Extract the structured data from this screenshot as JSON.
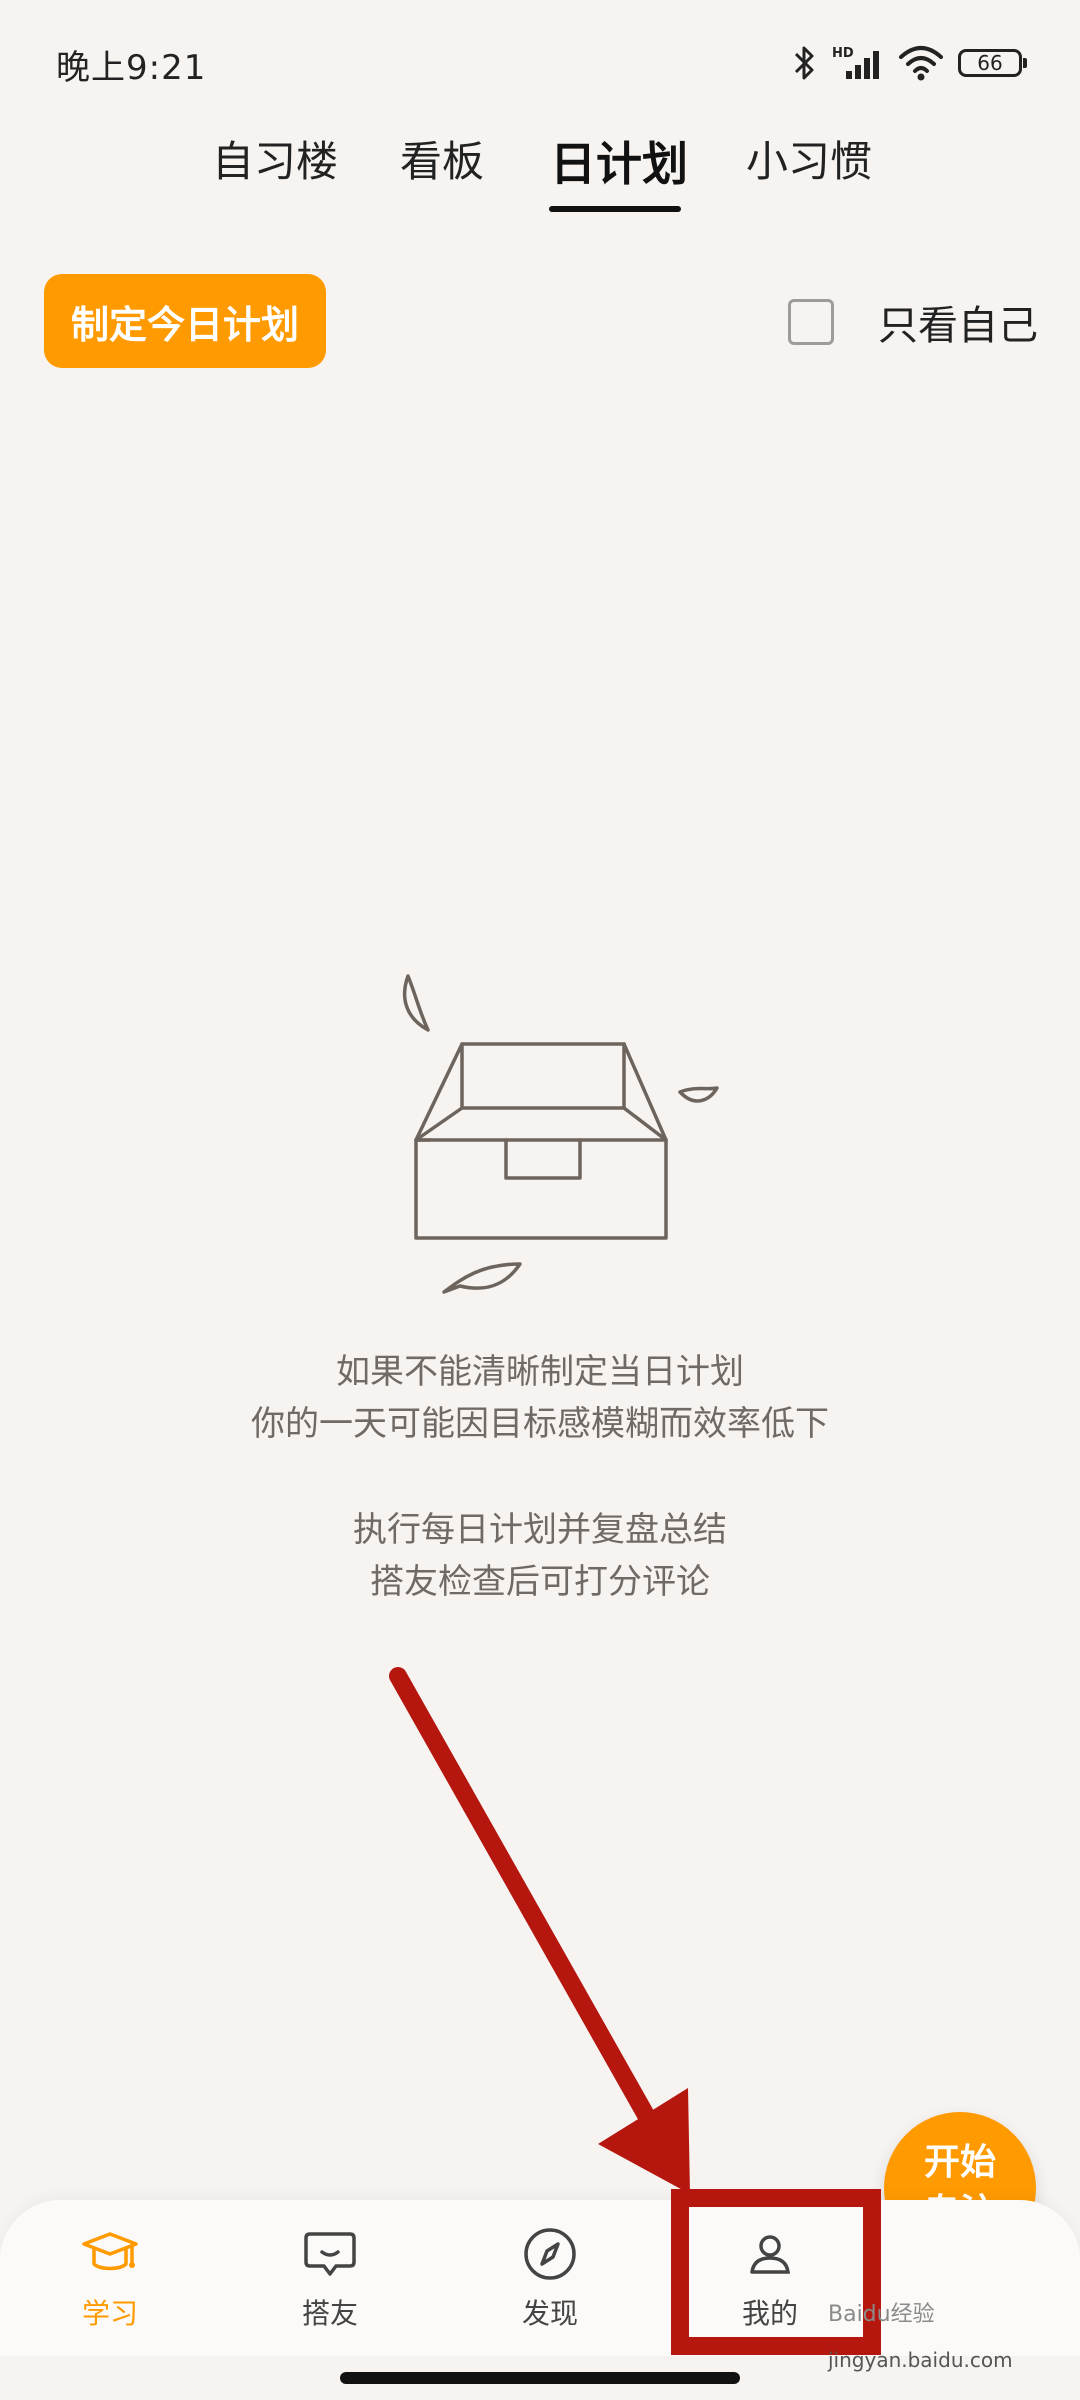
{
  "status_bar": {
    "time": "晚上9:21",
    "battery": "66",
    "icons": [
      "bluetooth-icon",
      "hd-signal-icon",
      "wifi-icon",
      "battery-icon"
    ]
  },
  "tabs": [
    {
      "label": "自习楼"
    },
    {
      "label": "看板"
    },
    {
      "label": "日计划",
      "active": true
    },
    {
      "label": "小习惯"
    }
  ],
  "actions": {
    "plan_button": "制定今日计划",
    "only_me_label": "只看自己",
    "only_me_checked": false
  },
  "empty_state": {
    "line1": "如果不能清晰制定当日计划",
    "line2": "你的一天可能因目标感模糊而效率低下",
    "line3": "执行每日计划并复盘总结",
    "line4": "搭友检查后可打分评论"
  },
  "focus_button": {
    "line1": "开始",
    "line2": "专注"
  },
  "bottom_nav": [
    {
      "label": "学习",
      "icon": "graduation-cap-icon",
      "active": true
    },
    {
      "label": "搭友",
      "icon": "chat-bubble-icon"
    },
    {
      "label": "发现",
      "icon": "compass-icon"
    },
    {
      "label": "我的",
      "icon": "person-icon"
    }
  ],
  "colors": {
    "accent": "#ff9a00",
    "background": "#f6f3f1",
    "annotation": "#b5170f"
  },
  "watermark": {
    "brand": "Baidu经验",
    "url": "jingyan.baidu.com"
  }
}
